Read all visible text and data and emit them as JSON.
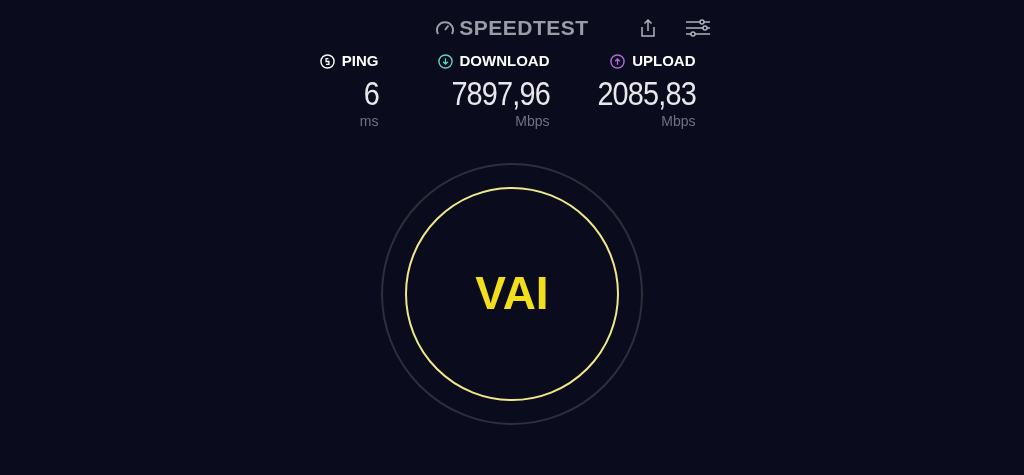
{
  "header": {
    "logo": "SPEEDTEST"
  },
  "metrics": [
    {
      "kind": "ping",
      "label": "PING",
      "value": "6",
      "unit": "ms",
      "color": "#ffffff"
    },
    {
      "kind": "download",
      "label": "DOWNLOAD",
      "value": "7897,96",
      "unit": "Mbps",
      "color": "#5fd3c4"
    },
    {
      "kind": "upload",
      "label": "UPLOAD",
      "value": "2085,83",
      "unit": "Mbps",
      "color": "#b06ad8"
    }
  ],
  "go_button": {
    "label": "VAI"
  }
}
